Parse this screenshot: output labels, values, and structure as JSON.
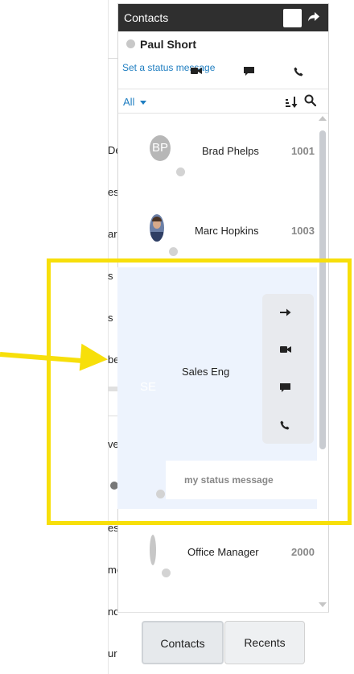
{
  "background_page": {
    "fragments": [
      "De",
      "es",
      "ar",
      "s",
      "s",
      "be",
      "ve",
      "es",
      "me",
      "nd",
      "ur"
    ]
  },
  "panel": {
    "title": "Contacts",
    "user": {
      "name": "Paul Short",
      "status_link": "Set a status message"
    },
    "filter": {
      "selected": "All"
    },
    "contacts": [
      {
        "initials": "BP",
        "name": "Brad Phelps",
        "ext": "1001"
      },
      {
        "name": "Marc Hopkins",
        "ext": "1003"
      },
      {
        "initials": "SE",
        "name": "Sales Eng",
        "status_message": "my status message"
      },
      {
        "name": "Office Manager",
        "ext": "2000"
      }
    ]
  },
  "footer": {
    "tabs": [
      "Contacts",
      "Recents"
    ]
  },
  "colors": {
    "header_bg": "#2f2f2f",
    "link_blue": "#1f7ec1",
    "selected_row_bg": "#edf3fd",
    "highlight_yellow": "#f7df0a"
  },
  "icons": [
    "share-arrow-icon",
    "video-icon",
    "chat-icon",
    "phone-icon",
    "sort-icon",
    "search-icon",
    "arrow-right-icon"
  ]
}
